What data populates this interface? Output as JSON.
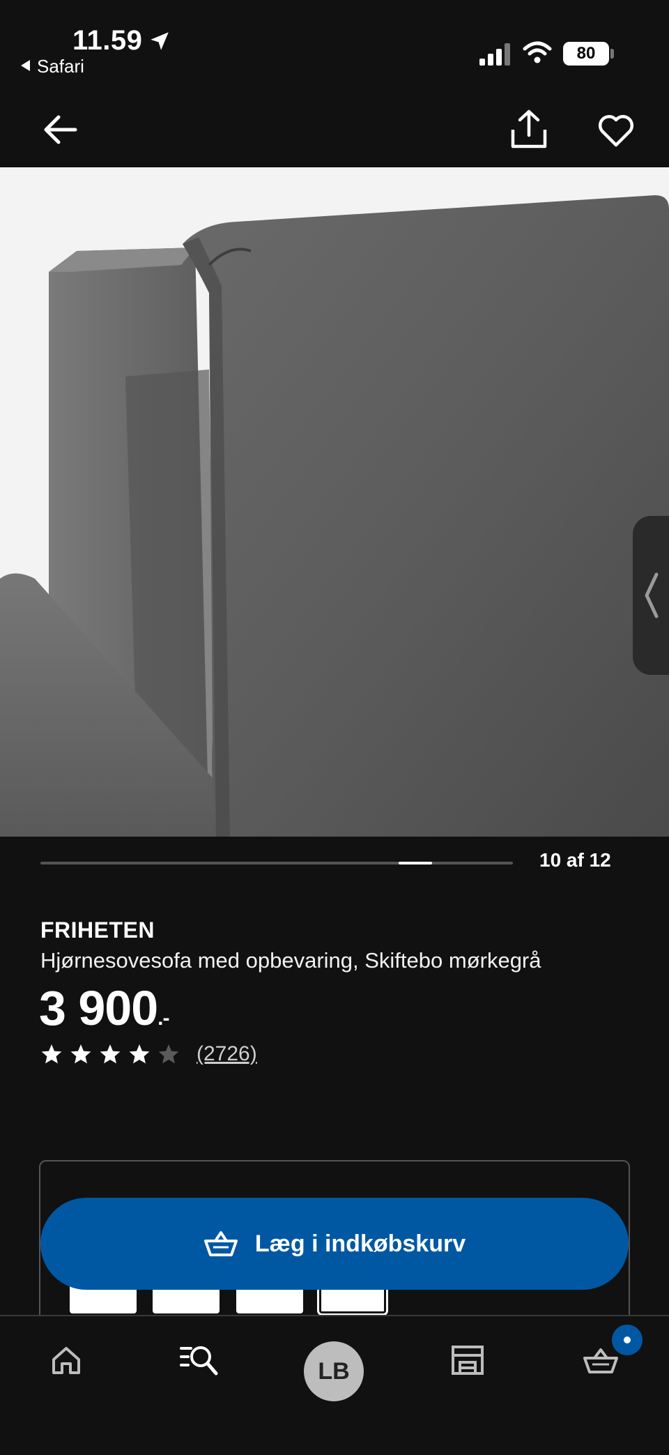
{
  "status_bar": {
    "time": "11.59",
    "back_app": "Safari",
    "battery": "80"
  },
  "gallery": {
    "counter": "10 af 12",
    "current": 10,
    "total": 12
  },
  "product": {
    "brand": "FRIHETEN",
    "description": "Hjørnesovesofa med opbevaring, Skiftebo mørkegrå",
    "price": "3 900",
    "price_suffix": ".-",
    "rating": 4,
    "rating_max": 5,
    "review_count": "(2726)"
  },
  "cart_button": {
    "label": "Læg i indkøbskurv"
  },
  "bottom_nav": {
    "avatar_initials": "LB",
    "items": [
      "home-icon",
      "search-icon",
      "profile-avatar",
      "store-icon",
      "cart-icon"
    ]
  },
  "colors": {
    "background": "#111111",
    "accent_blue": "#0058a3",
    "star_filled": "#ffffff",
    "star_empty": "#5a5a5a"
  }
}
